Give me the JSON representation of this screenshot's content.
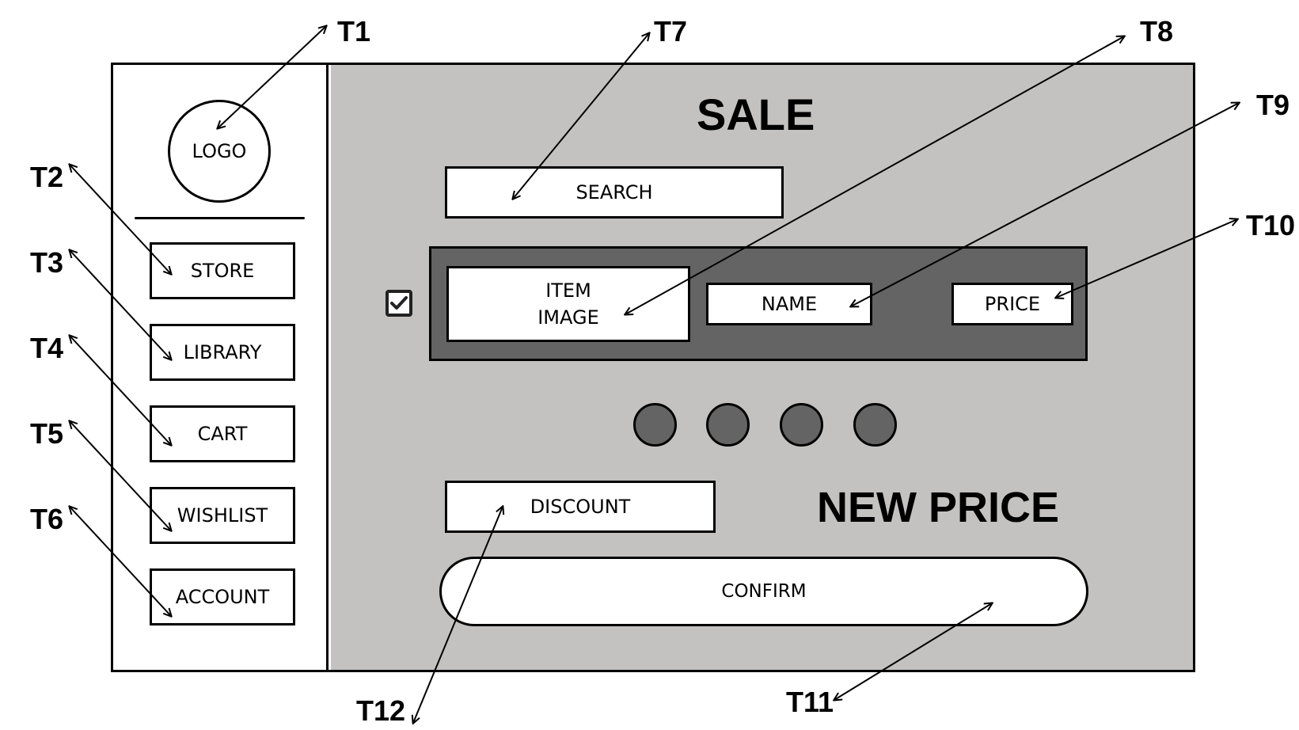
{
  "sidebar": {
    "logo": "LOGO",
    "items": [
      {
        "label": "STORE"
      },
      {
        "label": "LIBRARY"
      },
      {
        "label": "CART"
      },
      {
        "label": "WISHLIST"
      },
      {
        "label": "ACCOUNT"
      }
    ]
  },
  "main": {
    "title": "SALE",
    "search_label": "SEARCH",
    "item": {
      "image_label_line1": "ITEM",
      "image_label_line2": "IMAGE",
      "name_label": "NAME",
      "price_label": "PRICE",
      "checked": true
    },
    "pagination_dots": 4,
    "discount_label": "DISCOUNT",
    "new_price_label": "NEW PRICE",
    "confirm_label": "CONFIRM"
  },
  "annotations": [
    "T1",
    "T2",
    "T3",
    "T4",
    "T5",
    "T6",
    "T7",
    "T8",
    "T9",
    "T10",
    "T11",
    "T12"
  ],
  "colors": {
    "panel": "#c3c2c1",
    "item_row": "#646464",
    "dot": "#646464",
    "stroke": "#000000"
  }
}
